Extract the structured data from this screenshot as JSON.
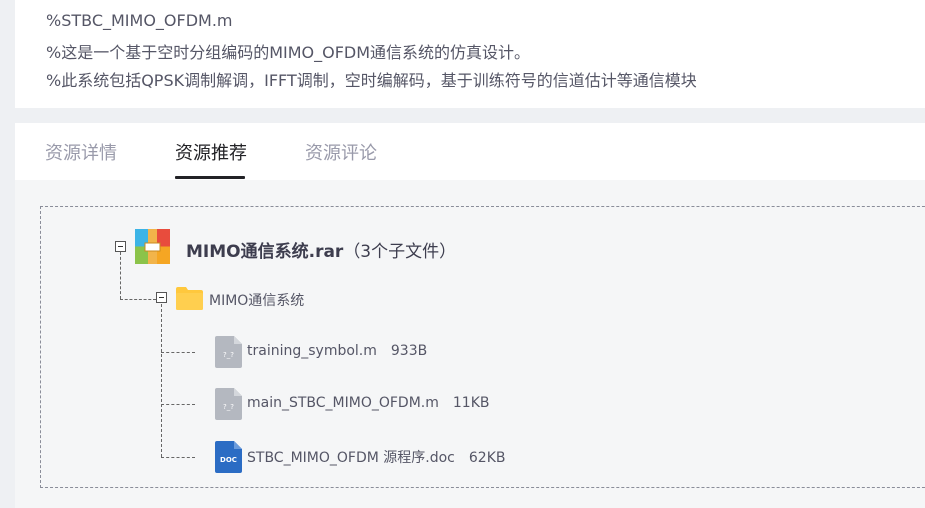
{
  "description": {
    "lines": [
      "%STBC_MIMO_OFDM.m",
      "%这是一个基于空时分组编码的MIMO_OFDM通信系统的仿真设计。",
      "%此系统包括QPSK调制解调，IFFT调制，空时编解码，基于训练符号的信道估计等通信模块"
    ]
  },
  "tabs": [
    {
      "label": "资源详情",
      "active": false
    },
    {
      "label": "资源推荐",
      "active": true
    },
    {
      "label": "资源评论",
      "active": false
    }
  ],
  "tree": {
    "root": {
      "name": "MIMO通信系统.rar",
      "suffix": "（3个子文件）",
      "icon": "rar-archive-icon"
    },
    "folder": {
      "name": "MIMO通信系统",
      "icon": "folder-icon"
    },
    "files": [
      {
        "name": "training_symbol.m",
        "size": "933B",
        "icon": "matlab-file-icon",
        "glyph": "?_?"
      },
      {
        "name": "main_STBC_MIMO_OFDM.m",
        "size": "11KB",
        "icon": "matlab-file-icon",
        "glyph": "?_?"
      },
      {
        "name": "STBC_MIMO_OFDM 源程序.doc",
        "size": "62KB",
        "icon": "word-doc-icon",
        "glyph": "DOC"
      }
    ]
  },
  "colors": {
    "folder": "#ffc83d",
    "unknown_file": "#b4b8c0",
    "doc_file": "#2b6cc4"
  }
}
